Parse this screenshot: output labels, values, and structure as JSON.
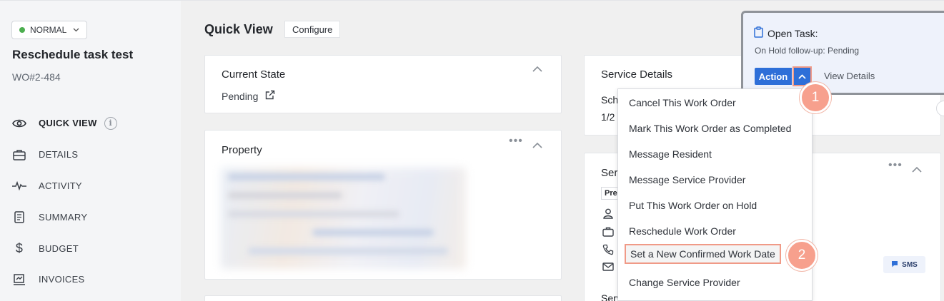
{
  "sidebar": {
    "priority": "NORMAL",
    "title": "Reschedule task test",
    "wo_number": "WO#2-484",
    "nav": [
      {
        "label": "QUICK VIEW",
        "icon": "eye-icon"
      },
      {
        "label": "DETAILS",
        "icon": "briefcase-icon"
      },
      {
        "label": "ACTIVITY",
        "icon": "pulse-icon"
      },
      {
        "label": "SUMMARY",
        "icon": "document-icon"
      },
      {
        "label": "BUDGET",
        "icon": "dollar-icon"
      },
      {
        "label": "INVOICES",
        "icon": "invoice-icon"
      }
    ]
  },
  "main": {
    "title": "Quick View",
    "configure_label": "Configure",
    "current_state": {
      "title": "Current State",
      "value": "Pending"
    },
    "property": {
      "title": "Property"
    },
    "service_details": {
      "title": "Service Details",
      "sched_label": "Sch",
      "sched_value": "1/2"
    },
    "service_card": {
      "title": "Ser",
      "tag": "Pre",
      "bottom_label": "Serv"
    }
  },
  "task": {
    "heading": "Open Task:",
    "subtext": "On Hold follow-up: Pending",
    "action_label": "Action",
    "view_details_label": "View Details"
  },
  "menu": {
    "items": [
      "Cancel This Work Order",
      "Mark This Work Order as Completed",
      "Message Resident",
      "Message Service Provider",
      "Put This Work Order on Hold",
      "Reschedule Work Order",
      "Set a New Confirmed Work Date",
      "Change Service Provider"
    ],
    "highlighted_index": 6
  },
  "annotations": {
    "badge1": "1",
    "badge2": "2"
  },
  "sms_label": "SMS",
  "colors": {
    "accent": "#2e6fd8",
    "highlight": "#f09a87",
    "status_green": "#4cae4f"
  }
}
